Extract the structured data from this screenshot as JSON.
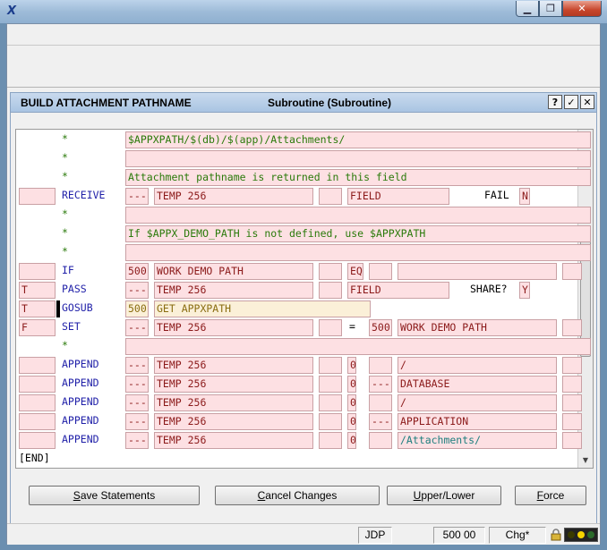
{
  "window": {
    "app_icon": "x-app-icon",
    "controls": [
      "minimize-icon",
      "restore-icon",
      "close-icon"
    ]
  },
  "dialog": {
    "name": "BUILD ATTACHMENT PATHNAME",
    "subtitle": "Subroutine  (Subroutine)",
    "help_label": "?",
    "ok_label": "✓",
    "close_label": "✕"
  },
  "rows": [
    {
      "kind": "comment",
      "star": "*",
      "text": "$APPXPATH/$(db)/$(app)/Attachments/"
    },
    {
      "kind": "comment",
      "star": "*",
      "text": ""
    },
    {
      "kind": "comment",
      "star": "*",
      "text": "Attachment pathname is returned in this field"
    },
    {
      "kind": "stmt",
      "label": "",
      "verb": "RECEIVE",
      "dec": "---",
      "field": "TEMP 256",
      "opt": "",
      "type": "FIELD",
      "extra_label": "FAIL",
      "extra_value": "N"
    },
    {
      "kind": "comment",
      "star": "*",
      "text": ""
    },
    {
      "kind": "comment",
      "star": "*",
      "text": "If $APPX_DEMO_PATH is not defined, use $APPXPATH"
    },
    {
      "kind": "comment",
      "star": "*",
      "text": ""
    },
    {
      "kind": "stmt",
      "label": "",
      "verb": "IF",
      "dec": "500",
      "field": "WORK DEMO PATH",
      "opt": "",
      "type": "EQ",
      "extra_label": "",
      "extra_value": ""
    },
    {
      "kind": "stmt",
      "label": "T",
      "verb": "PASS",
      "dec": "---",
      "field": "TEMP 256",
      "opt": "",
      "type": "FIELD",
      "extra_label": "SHARE?",
      "extra_value": "Y"
    },
    {
      "kind": "stmt",
      "label": "T",
      "verb": "GOSUB",
      "dec": "500",
      "field": "GET APPXPATH",
      "opt": "",
      "type": "",
      "extra_label": "",
      "extra_value": ""
    },
    {
      "kind": "stmt",
      "label": "F",
      "verb": "SET",
      "dec": "---",
      "field": "TEMP 256",
      "opt": "",
      "type": "=",
      "extra_label": "500",
      "extra_value": "WORK DEMO PATH"
    },
    {
      "kind": "comment",
      "star": "*",
      "text": ""
    },
    {
      "kind": "stmt",
      "label": "",
      "verb": "APPEND",
      "dec": "---",
      "field": "TEMP 256",
      "opt": "",
      "type": "0",
      "extra_label": "",
      "extra_value": "/"
    },
    {
      "kind": "stmt",
      "label": "",
      "verb": "APPEND",
      "dec": "---",
      "field": "TEMP 256",
      "opt": "",
      "type": "0",
      "extra_label": "---",
      "extra_value": "DATABASE"
    },
    {
      "kind": "stmt",
      "label": "",
      "verb": "APPEND",
      "dec": "---",
      "field": "TEMP 256",
      "opt": "",
      "type": "0",
      "extra_label": "",
      "extra_value": "/"
    },
    {
      "kind": "stmt",
      "label": "",
      "verb": "APPEND",
      "dec": "---",
      "field": "TEMP 256",
      "opt": "",
      "type": "0",
      "extra_label": "---",
      "extra_value": "APPLICATION"
    },
    {
      "kind": "stmt",
      "label": "",
      "verb": "APPEND",
      "dec": "---",
      "field": "TEMP 256",
      "opt": "",
      "type": "0",
      "extra_label": "",
      "extra_value": "/Attachments/"
    }
  ],
  "end_marker": "[END]",
  "buttons": {
    "save": {
      "accel": "S",
      "rest": "ave Statements"
    },
    "cancel": {
      "accel": "C",
      "rest": "ancel Changes"
    },
    "case": {
      "accel": "U",
      "rest": "pper/Lower"
    },
    "force": {
      "accel": "F",
      "rest": "orce"
    }
  },
  "status": {
    "user": "JDP",
    "value": "500 00",
    "mode": "Chg*",
    "lights": [
      "#3a3a00",
      "#f5d400",
      "#2a6a2a"
    ]
  }
}
